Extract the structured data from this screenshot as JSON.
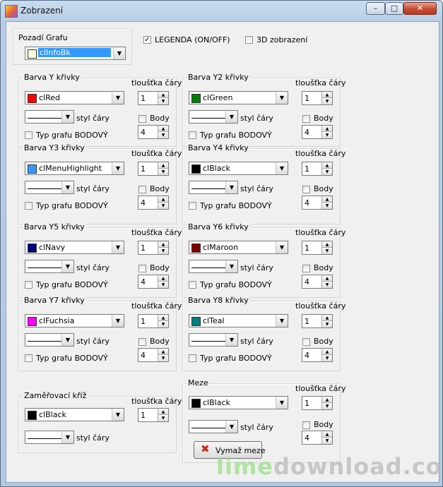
{
  "window": {
    "title": "Zobrazení",
    "min_glyph": "–",
    "max_glyph": "□",
    "close_glyph": "✕"
  },
  "background_group": {
    "label": "Pozadí Grafu",
    "color_name": "clInfoBk",
    "swatch": "#ffffe1"
  },
  "legend": {
    "label": "LEGENDA (ON/OFF)",
    "checked": true,
    "check_glyph": "✓"
  },
  "view3d": {
    "label": "3D zobrazení",
    "checked": false
  },
  "common": {
    "thickness_label": "tloušťka čáry",
    "style_label": "styl čáry",
    "points_label": "Body",
    "scatter_label": "Typ grafu BODOVÝ",
    "arrow": "▼",
    "up": "▲",
    "down": "▼"
  },
  "curves": [
    {
      "label": "Barva Y křivky",
      "color_name": "clRed",
      "swatch": "#ff0000",
      "thickness": "1",
      "points": "4"
    },
    {
      "label": "Barva Y2 křivky",
      "color_name": "clGreen",
      "swatch": "#008000",
      "thickness": "1",
      "points": "4"
    },
    {
      "label": "Barva Y3 křivky",
      "color_name": "clMenuHighlight",
      "swatch": "#3399ff",
      "thickness": "1",
      "points": "4"
    },
    {
      "label": "Barva Y4 křivky",
      "color_name": "clBlack",
      "swatch": "#000000",
      "thickness": "1",
      "points": "4"
    },
    {
      "label": "Barva Y5 křivky",
      "color_name": "clNavy",
      "swatch": "#000080",
      "thickness": "1",
      "points": "4"
    },
    {
      "label": "Barva Y6 křivky",
      "color_name": "clMaroon",
      "swatch": "#800000",
      "thickness": "1",
      "points": "4"
    },
    {
      "label": "Barva Y7 křivky",
      "color_name": "clFuchsia",
      "swatch": "#ff00ff",
      "thickness": "1",
      "points": "4"
    },
    {
      "label": "Barva Y8 křivky",
      "color_name": "clTeal",
      "swatch": "#008080",
      "thickness": "1",
      "points": "4"
    }
  ],
  "crosshair": {
    "label": "Zaměřovací kříž",
    "color_name": "clBlack",
    "swatch": "#000000",
    "thickness": "1"
  },
  "limits": {
    "label": "Meze",
    "color_name": "clBlack",
    "swatch": "#000000",
    "thickness": "1",
    "points": "4",
    "clear_button": "Vymaž meze",
    "clear_icon": "✖"
  },
  "watermark": {
    "part_a": "lime",
    "part_b": "download.com"
  }
}
